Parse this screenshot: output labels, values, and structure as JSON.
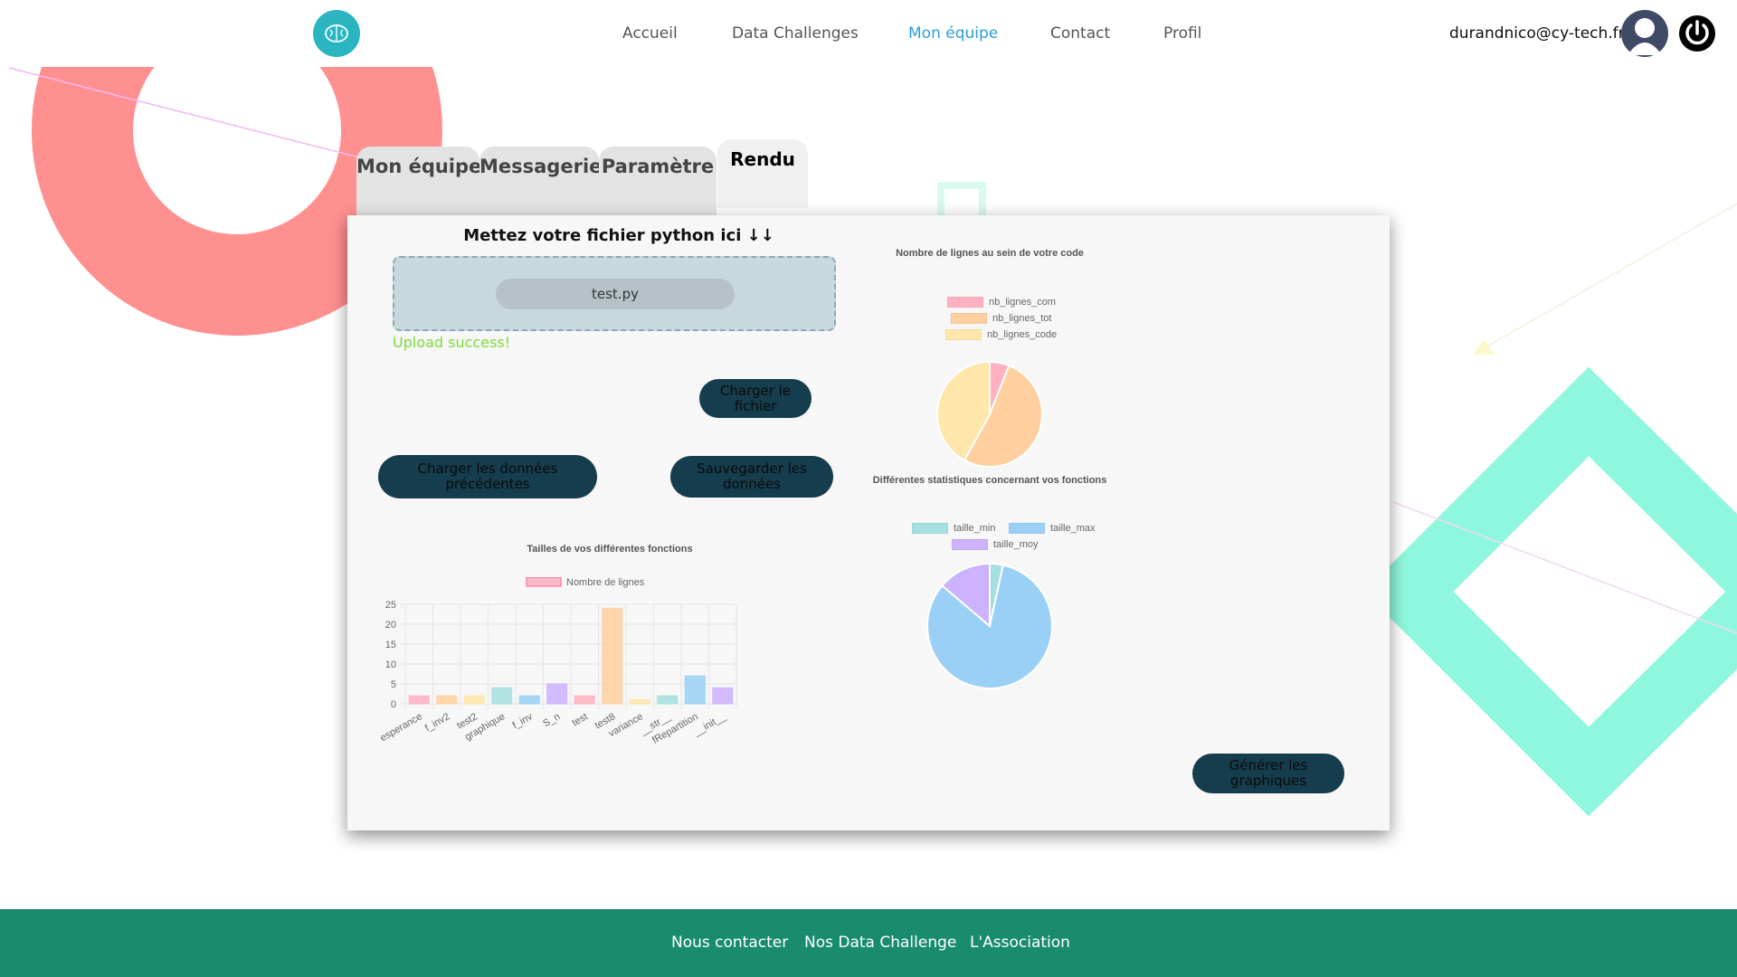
{
  "header": {
    "nav": [
      {
        "label": "Accueil",
        "active": false
      },
      {
        "label": "Data Challenges",
        "active": false
      },
      {
        "label": "Mon équipe",
        "active": true
      },
      {
        "label": "Contact",
        "active": false
      },
      {
        "label": "Profil",
        "active": false
      }
    ],
    "user_email": "durandnico@cy-tech.fr",
    "icons": {
      "logo": "brain-icon",
      "avatar": "user-avatar-icon",
      "power": "power-icon"
    }
  },
  "tabs": [
    {
      "label": "Mon équipe",
      "active": false
    },
    {
      "label": "Messagerie",
      "active": false
    },
    {
      "label": "Paramètre",
      "active": false
    },
    {
      "label": "Rendu",
      "active": true
    }
  ],
  "upload": {
    "title": "Mettez votre fichier python ici ↓↓",
    "file_name": "test.py",
    "status": "Upload success!"
  },
  "buttons": {
    "load_file": "Charger le fichier",
    "load_previous": "Charger les données précédentes",
    "save_data": "Sauvegarder les données",
    "generate_charts": "Générer les graphiques"
  },
  "chart_data": [
    {
      "type": "pie",
      "title": "Nombre de lignes au sein de votre code",
      "labels": [
        "nb_lignes_com",
        "nb_lignes_tot",
        "nb_lignes_code"
      ],
      "values": [
        6,
        52,
        42
      ],
      "colors": [
        "#ffb1c1",
        "#ffcf9f",
        "#ffe6aa"
      ],
      "legend": "top"
    },
    {
      "type": "pie",
      "title": "Différentes statistiques concernant vos fonctions",
      "labels": [
        "taille_min",
        "taille_max",
        "taille_moy"
      ],
      "values": [
        1,
        24,
        4
      ],
      "colors": [
        "#a5dfdf",
        "#9ad0f5",
        "#ccb2ff"
      ],
      "legend": "top"
    },
    {
      "type": "bar",
      "title": "Tailles de vos différentes fonctions",
      "series": [
        {
          "name": "Nombre de lignes",
          "values": [
            2,
            2,
            2,
            4,
            2,
            5,
            2,
            24,
            1,
            2,
            7,
            4
          ]
        }
      ],
      "categories": [
        "esperance",
        "f_inv2",
        "test2",
        "graphique",
        "f_inv",
        "S_n",
        "test",
        "test8",
        "variance",
        "__str__",
        "fRepartition",
        "__init__"
      ],
      "colors": [
        "#ffb1c1",
        "#ffcf9f",
        "#ffe6aa",
        "#a5dfdf",
        "#9ad0f5",
        "#ccb2ff",
        "#ffb1c1",
        "#ffcf9f",
        "#ffe6aa",
        "#a5dfdf",
        "#9ad0f5",
        "#ccb2ff"
      ],
      "ylim": [
        0,
        25
      ],
      "yticks": [
        0,
        5,
        10,
        15,
        20,
        25
      ],
      "grid": true,
      "legend": "top"
    }
  ],
  "footer": {
    "links": [
      "Nous contacter",
      "Nos Data Challenge",
      "L'Association"
    ]
  }
}
